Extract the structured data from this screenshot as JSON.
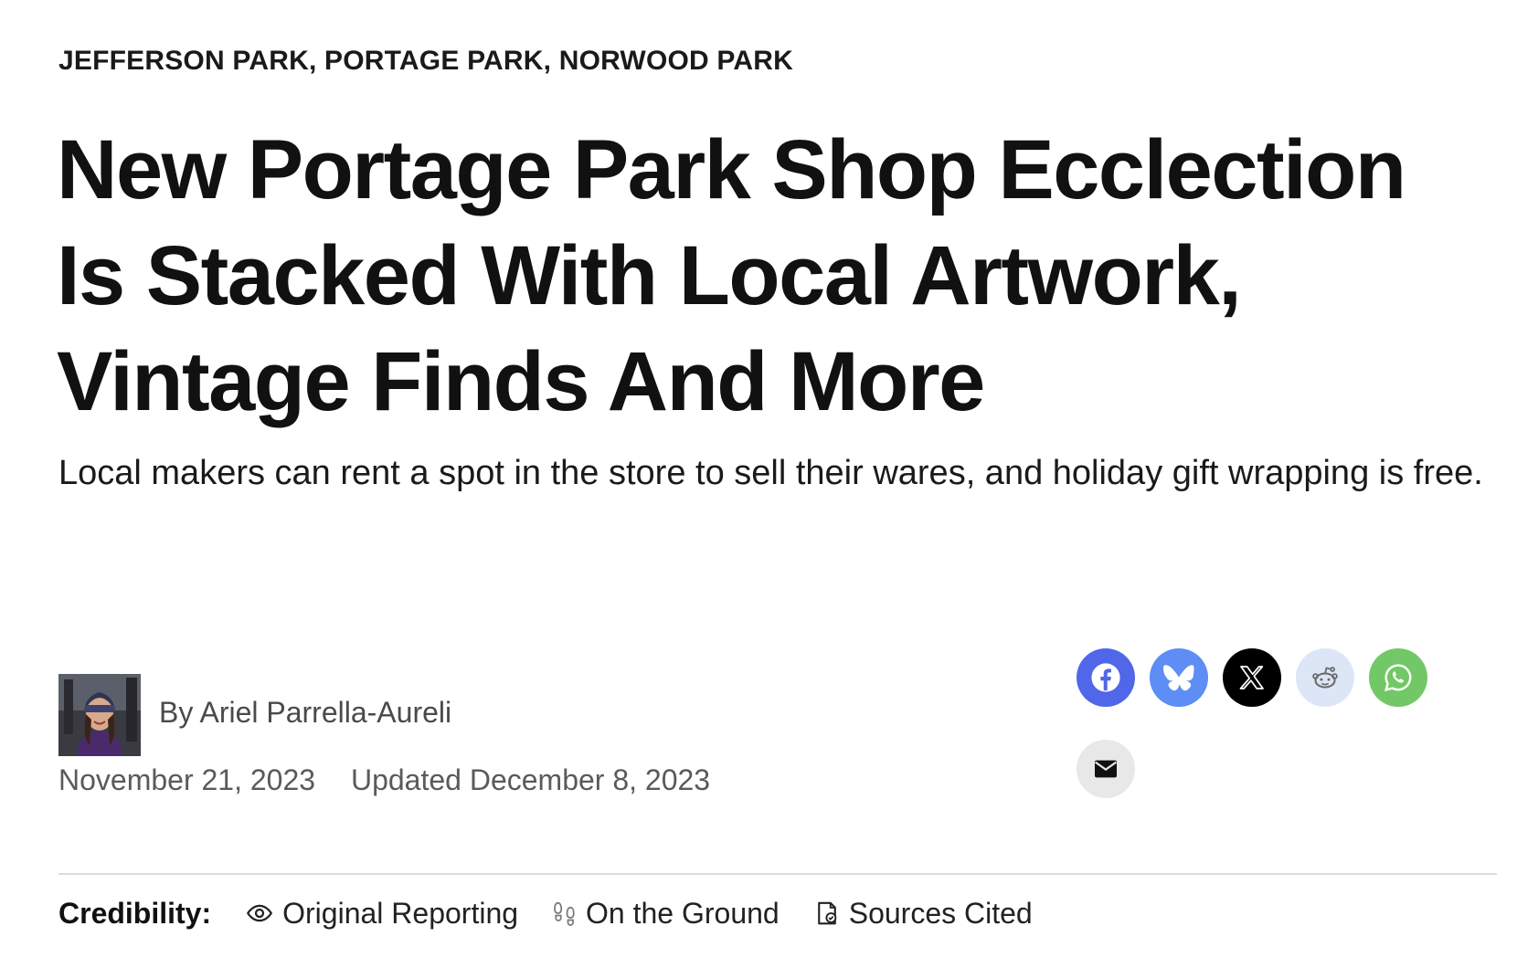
{
  "article": {
    "kicker": "JEFFERSON PARK, PORTAGE PARK, NORWOOD PARK",
    "headline": "New Portage Park Shop Ecclection Is Stacked With Local Artwork, Vintage Finds And More",
    "dek": "Local makers can rent a spot in the store to sell their wares, and holiday gift wrapping is free."
  },
  "author": {
    "by_prefix": "By",
    "name": "Ariel Parrella-Aureli"
  },
  "dates": {
    "published": "November 21, 2023",
    "updated": "Updated December 8, 2023"
  },
  "share": {
    "buttons": [
      {
        "name": "facebook",
        "icon": "facebook-icon",
        "bg": "#4f67e8",
        "fg": "#ffffff"
      },
      {
        "name": "bluesky",
        "icon": "butterfly-icon",
        "bg": "#5d8df5",
        "fg": "#ffffff"
      },
      {
        "name": "x",
        "icon": "x-icon",
        "bg": "#000000",
        "fg": "#ffffff"
      },
      {
        "name": "reddit",
        "icon": "reddit-icon",
        "bg": "#dde6f7",
        "fg": "#6b6b6b"
      },
      {
        "name": "whatsapp",
        "icon": "whatsapp-icon",
        "bg": "#72c866",
        "fg": "#ffffff"
      },
      {
        "name": "email",
        "icon": "envelope-icon",
        "bg": "#e8e8e8",
        "fg": "#111111"
      }
    ]
  },
  "credibility": {
    "label": "Credibility:",
    "items": [
      {
        "label": "Original Reporting",
        "icon": "eye-icon"
      },
      {
        "label": "On the Ground",
        "icon": "footprints-icon"
      },
      {
        "label": "Sources Cited",
        "icon": "document-check-icon"
      }
    ]
  }
}
